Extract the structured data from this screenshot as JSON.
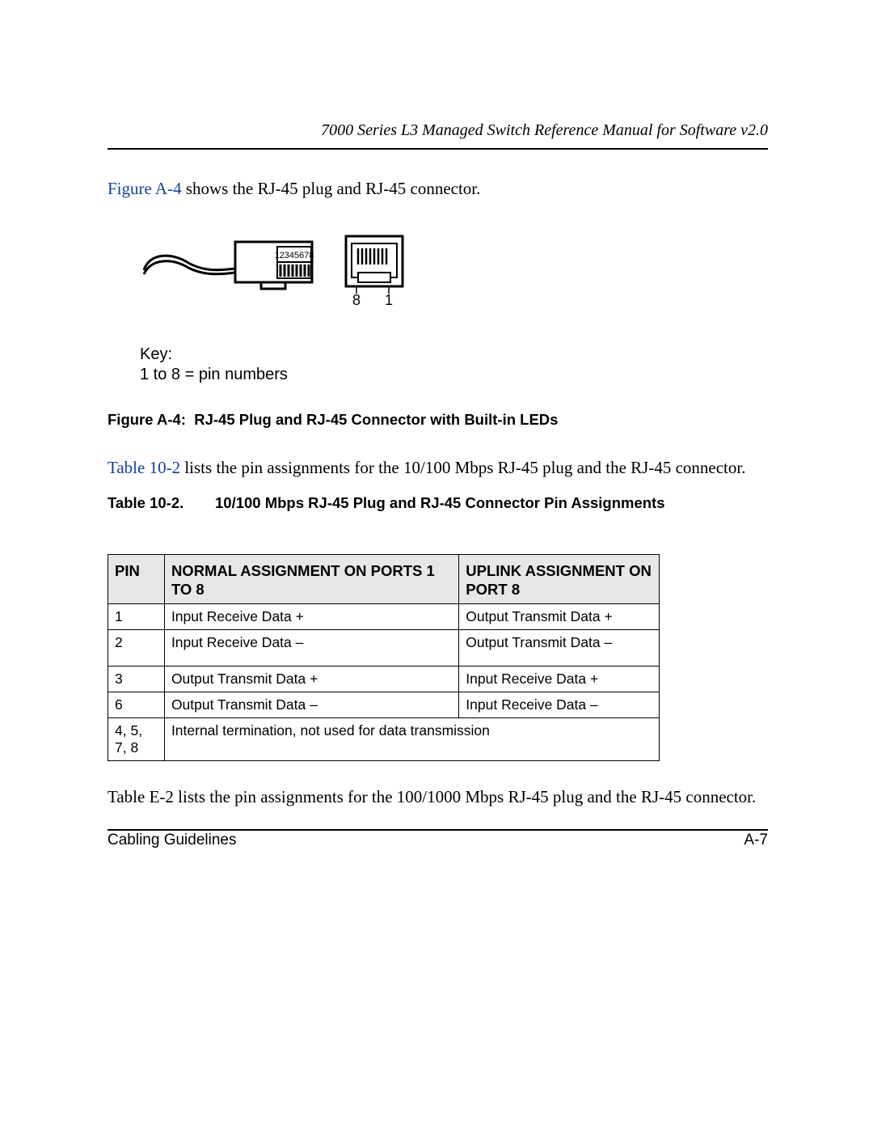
{
  "header": {
    "title": "7000 Series L3 Managed Switch Reference Manual for Software v2.0"
  },
  "intro": {
    "link_text": "Figure A-4",
    "rest": " shows the RJ-45 plug and RJ-45 connector."
  },
  "figure": {
    "pin_label": "12345678",
    "jack_left": "8",
    "jack_right": "1",
    "key_heading": "Key:",
    "key_line": "1 to 8 = pin numbers",
    "caption_label": "Figure A-4:",
    "caption_text": "RJ-45 Plug and RJ-45 Connector with Built-in LEDs"
  },
  "para2": {
    "link_text": "Table 10-2",
    "rest": " lists the pin assignments for the 10/100 Mbps RJ-45 plug and the RJ-45 connector."
  },
  "table": {
    "caption_label": "Table 10-2.",
    "caption_text": "10/100 Mbps RJ-45 Plug and RJ-45 Connector Pin Assignments",
    "headers": {
      "pin": "Pin",
      "normal": "Normal Assignment on Ports 1 to 8",
      "uplink": "Uplink Assignment on Port 8"
    },
    "rows": [
      {
        "pin": "1",
        "normal": "Input Receive Data +",
        "uplink": "Output Transmit Data +"
      },
      {
        "pin": "2",
        "normal": "Input Receive Data –",
        "uplink": "Output Transmit Data –"
      },
      {
        "pin": "3",
        "normal": "Output Transmit Data +",
        "uplink": "Input Receive Data +"
      },
      {
        "pin": "6",
        "normal": "Output Transmit Data –",
        "uplink": "Input Receive Data –"
      }
    ],
    "span_row": {
      "pin": "4, 5, 7, 8",
      "text": "Internal termination, not used for data transmission"
    }
  },
  "para3": "Table E-2 lists the pin assignments for the 100/1000 Mbps RJ-45 plug and the RJ-45 connector.",
  "footer": {
    "left": "Cabling Guidelines",
    "right": "A-7"
  }
}
